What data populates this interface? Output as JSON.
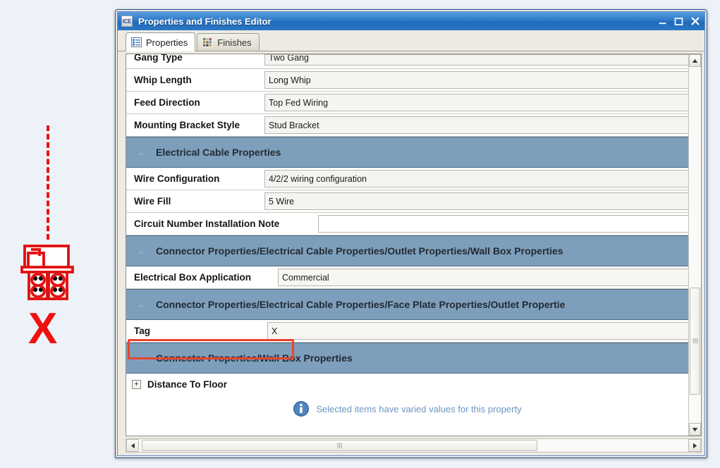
{
  "window": {
    "app_icon_text": "ICE",
    "title": "Properties and Finishes Editor",
    "minimize_label": "Minimize",
    "maximize_label": "Maximize",
    "close_label": "Close"
  },
  "tabs": [
    {
      "label": "Properties",
      "icon": "list-icon",
      "active": true
    },
    {
      "label": "Finishes",
      "icon": "color-grid-icon",
      "active": false
    }
  ],
  "grid": {
    "rows": [
      {
        "kind": "property",
        "label": "Gang Type",
        "value": "Two Gang",
        "clipped": true
      },
      {
        "kind": "property",
        "label": "Whip Length",
        "value": "Long Whip"
      },
      {
        "kind": "property",
        "label": "Feed Direction",
        "value": "Top Fed Wiring"
      },
      {
        "kind": "property",
        "label": "Mounting Bracket Style",
        "value": "Stud Bracket"
      },
      {
        "kind": "section",
        "title": "Electrical Cable Properties",
        "expanded": true
      },
      {
        "kind": "property",
        "label": "Wire Configuration",
        "value": "4/2/2 wiring configuration"
      },
      {
        "kind": "property",
        "label": "Wire Fill",
        "value": "5 Wire"
      },
      {
        "kind": "property",
        "label": "Circuit Number Installation Note",
        "value": ""
      },
      {
        "kind": "section",
        "title": "Connector Properties/Electrical Cable Properties/Outlet Properties/Wall Box Properties",
        "expanded": true
      },
      {
        "kind": "property",
        "label": "Electrical Box Application",
        "value": "Commercial"
      },
      {
        "kind": "section",
        "title": "Connector Properties/Electrical Cable Properties/Face Plate Properties/Outlet Propertie",
        "expanded": true
      },
      {
        "kind": "property",
        "label": "Tag",
        "value": "X",
        "highlighted": true
      },
      {
        "kind": "section",
        "title": "Connector Properties/Wall Box Properties",
        "expanded": true
      },
      {
        "kind": "tree",
        "label": "Distance To Floor",
        "expander": "+"
      }
    ],
    "info_message": "Selected items have varied values for this property",
    "info_icon": "info-icon"
  },
  "scrollbars": {
    "vertical": {
      "up_label": "Scroll up",
      "down_label": "Scroll down",
      "thumb_label": "Vertical scroll thumb"
    },
    "horizontal": {
      "left_label": "Scroll left",
      "right_label": "Scroll right",
      "thumb_label": "Horizontal scroll thumb"
    }
  },
  "annotation": {
    "tag_letter": "X",
    "symbol_name": "duplex-outlet-symbol",
    "leader_line": "dashed-leader-line",
    "highlight_color": "#e8442f",
    "marker_color": "#ee1111"
  }
}
